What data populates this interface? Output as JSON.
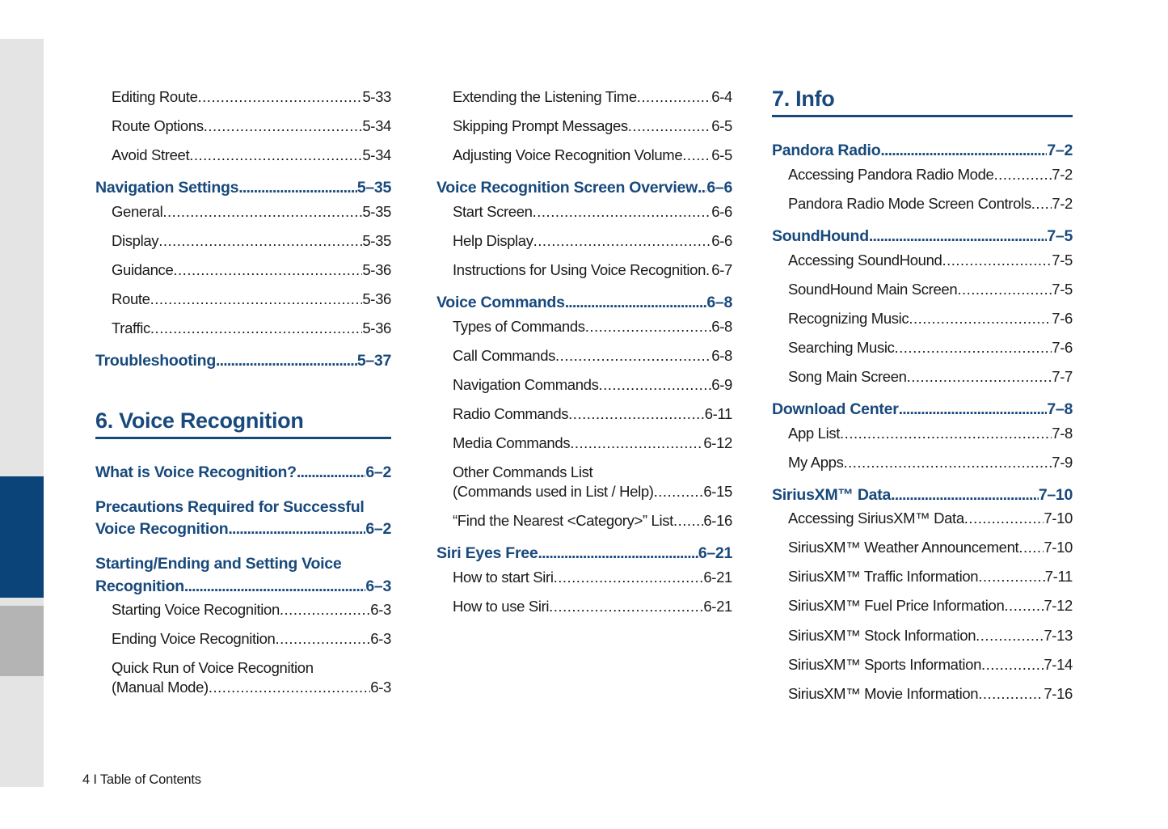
{
  "footer": {
    "text": "4 I Table of Contents"
  },
  "colors": {
    "accent_blue": "#18497c",
    "tab_blue": "#0a4478",
    "tab_gray": "#b4b4b4",
    "edge_strip_gray": "#e4e4e4",
    "body_text": "#1a1a1a"
  },
  "edge_index": {
    "strip_label": "thumb-index-strip",
    "tabs": [
      {
        "name": "active-chapter-tab",
        "color": "#0a4478"
      },
      {
        "name": "next-chapter-tab",
        "color": "#b4b4b4"
      }
    ]
  },
  "columns": [
    {
      "id": "column-1",
      "blocks": [
        {
          "type": "entry",
          "level": 2,
          "title": "Editing Route",
          "page": "5-33"
        },
        {
          "type": "entry",
          "level": 2,
          "title": "Route Options",
          "page": "5-34"
        },
        {
          "type": "entry",
          "level": 2,
          "title": "Avoid Street",
          "page": "5-34"
        },
        {
          "type": "entry",
          "level": 1,
          "title": "Navigation Settings",
          "page": "5–35"
        },
        {
          "type": "entry",
          "level": 2,
          "title": "General",
          "page": "5-35"
        },
        {
          "type": "entry",
          "level": 2,
          "title": "Display",
          "page": "5-35"
        },
        {
          "type": "entry",
          "level": 2,
          "title": "Guidance",
          "page": "5-36"
        },
        {
          "type": "entry",
          "level": 2,
          "title": "Route",
          "page": "5-36"
        },
        {
          "type": "entry",
          "level": 2,
          "title": "Traffic",
          "page": "5-36"
        },
        {
          "type": "entry",
          "level": 1,
          "title": "Troubleshooting",
          "page": "5–37"
        },
        {
          "type": "chapter",
          "title": "6. Voice Recognition"
        },
        {
          "type": "entry",
          "level": 1,
          "title": "What is Voice Recognition?",
          "page": "6–2"
        },
        {
          "type": "entry",
          "level": 1,
          "wrap": true,
          "line1": "Precautions Required for Successful",
          "title": "Voice Recognition",
          "page": "6–2"
        },
        {
          "type": "entry",
          "level": 1,
          "wrap": true,
          "line1": "Starting/Ending and Setting Voice",
          "title": "Recognition",
          "page": "6–3"
        },
        {
          "type": "entry",
          "level": 2,
          "title": "Starting Voice Recognition",
          "page": "6-3"
        },
        {
          "type": "entry",
          "level": 2,
          "title": "Ending Voice Recognition",
          "page": "6-3"
        },
        {
          "type": "entry",
          "level": 2,
          "wrap": true,
          "line1": "Quick Run of Voice Recognition",
          "title": "(Manual Mode)",
          "page": "6-3"
        }
      ]
    },
    {
      "id": "column-2",
      "blocks": [
        {
          "type": "entry",
          "level": 2,
          "title": "Extending the Listening Time",
          "page": "6-4"
        },
        {
          "type": "entry",
          "level": 2,
          "title": "Skipping Prompt Messages",
          "page": "6-5"
        },
        {
          "type": "entry",
          "level": 2,
          "title": "Adjusting Voice Recognition Volume",
          "page": "6-5"
        },
        {
          "type": "entry",
          "level": 1,
          "title": "Voice Recognition Screen Overview",
          "page": "6–6"
        },
        {
          "type": "entry",
          "level": 2,
          "title": "Start Screen",
          "page": "6-6"
        },
        {
          "type": "entry",
          "level": 2,
          "title": "Help Display",
          "page": "6-6"
        },
        {
          "type": "entry",
          "level": 2,
          "title": "Instructions for Using Voice Recognition",
          "page": "6-7"
        },
        {
          "type": "entry",
          "level": 1,
          "title": "Voice Commands",
          "page": "6–8"
        },
        {
          "type": "entry",
          "level": 2,
          "title": "Types of Commands",
          "page": "6-8"
        },
        {
          "type": "entry",
          "level": 2,
          "title": "Call Commands",
          "page": "6-8"
        },
        {
          "type": "entry",
          "level": 2,
          "title": "Navigation Commands",
          "page": "6-9"
        },
        {
          "type": "entry",
          "level": 2,
          "title": "Radio Commands",
          "page": "6-11"
        },
        {
          "type": "entry",
          "level": 2,
          "title": "Media Commands",
          "page": "6-12"
        },
        {
          "type": "entry",
          "level": 2,
          "wrap": true,
          "line1": "Other Commands List",
          "title": "(Commands used in List / Help)",
          "page": "6-15"
        },
        {
          "type": "entry",
          "level": 2,
          "title": "“Find the Nearest <Category>” List",
          "page": "6-16"
        },
        {
          "type": "entry",
          "level": 1,
          "title": "Siri Eyes Free",
          "page": "6–21"
        },
        {
          "type": "entry",
          "level": 2,
          "title": "How to start Siri",
          "page": "6-21"
        },
        {
          "type": "entry",
          "level": 2,
          "title": "How to use Siri",
          "page": "6-21"
        }
      ]
    },
    {
      "id": "column-3",
      "blocks": [
        {
          "type": "chapter",
          "title": "7. Info",
          "first": true
        },
        {
          "type": "entry",
          "level": 1,
          "title": "Pandora Radio",
          "page": "7–2"
        },
        {
          "type": "entry",
          "level": 2,
          "title": "Accessing Pandora Radio Mode",
          "page": "7-2"
        },
        {
          "type": "entry",
          "level": 2,
          "title": "Pandora Radio Mode Screen Controls",
          "page": "7-2"
        },
        {
          "type": "entry",
          "level": 1,
          "title": "SoundHound",
          "page": "7–5"
        },
        {
          "type": "entry",
          "level": 2,
          "title": "Accessing SoundHound",
          "page": "7-5"
        },
        {
          "type": "entry",
          "level": 2,
          "title": "SoundHound Main Screen",
          "page": "7-5"
        },
        {
          "type": "entry",
          "level": 2,
          "title": "Recognizing Music",
          "page": "7-6"
        },
        {
          "type": "entry",
          "level": 2,
          "title": "Searching Music",
          "page": "7-6"
        },
        {
          "type": "entry",
          "level": 2,
          "title": "Song Main Screen",
          "page": "7-7"
        },
        {
          "type": "entry",
          "level": 1,
          "title": "Download Center",
          "page": "7–8"
        },
        {
          "type": "entry",
          "level": 2,
          "title": "App List",
          "page": "7-8"
        },
        {
          "type": "entry",
          "level": 2,
          "title": "My Apps",
          "page": "7-9"
        },
        {
          "type": "entry",
          "level": 1,
          "title": "SiriusXM™ Data",
          "page": "7–10"
        },
        {
          "type": "entry",
          "level": 2,
          "title": "Accessing SiriusXM™ Data",
          "page": "7-10"
        },
        {
          "type": "entry",
          "level": 2,
          "title": "SiriusXM™ Weather Announcement",
          "page": "7-10"
        },
        {
          "type": "entry",
          "level": 2,
          "title": "SiriusXM™ Traffic Information",
          "page": "7-11"
        },
        {
          "type": "entry",
          "level": 2,
          "title": "SiriusXM™ Fuel Price Information",
          "page": "7-12"
        },
        {
          "type": "entry",
          "level": 2,
          "title": "SiriusXM™ Stock Information",
          "page": "7-13"
        },
        {
          "type": "entry",
          "level": 2,
          "title": "SiriusXM™ Sports Information",
          "page": "7-14"
        },
        {
          "type": "entry",
          "level": 2,
          "title": "SiriusXM™ Movie Information",
          "page": "7-16"
        }
      ]
    }
  ]
}
